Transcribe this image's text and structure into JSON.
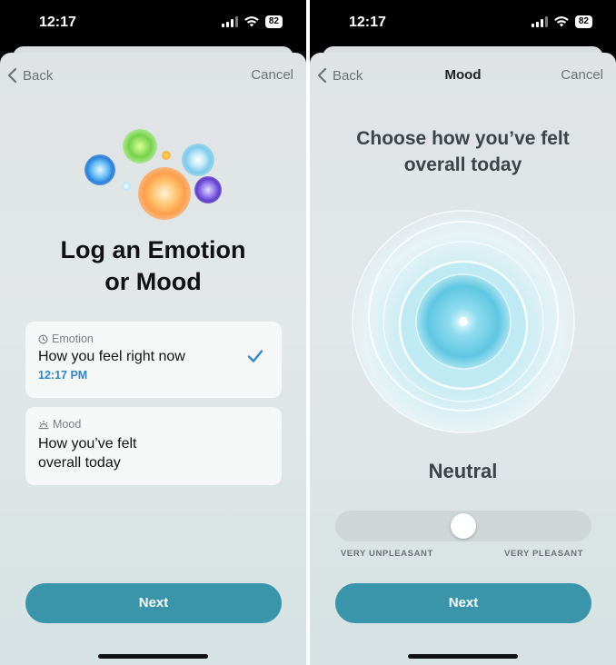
{
  "status_bar": {
    "time": "12:17",
    "battery": "82"
  },
  "screen_left": {
    "nav": {
      "back_label": "Back",
      "cancel_label": "Cancel"
    },
    "title_line1": "Log an Emotion",
    "title_line2": "or Mood",
    "options": [
      {
        "label": "Emotion",
        "text": "How you feel right now",
        "time": "12:17 PM",
        "selected": true,
        "icon": "clock-icon"
      },
      {
        "label": "Mood",
        "text_line1": "How you’ve felt",
        "text_line2": "overall today",
        "selected": false,
        "icon": "sunrise-icon"
      }
    ],
    "next_label": "Next",
    "accent": "#3a95ab"
  },
  "screen_right": {
    "nav": {
      "back_label": "Back",
      "title": "Mood",
      "cancel_label": "Cancel"
    },
    "heading_line1": "Choose how you’ve felt",
    "heading_line2": "overall today",
    "mood_value": "Neutral",
    "slider": {
      "position": 0.5,
      "left_label": "VERY UNPLEASANT",
      "right_label": "VERY PLEASANT"
    },
    "next_label": "Next"
  }
}
